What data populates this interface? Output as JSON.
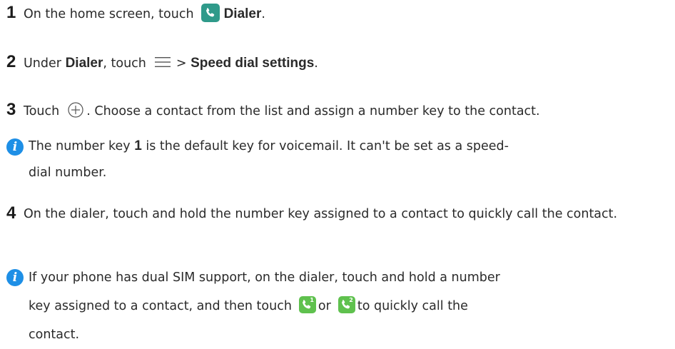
{
  "steps": [
    {
      "number": "1",
      "prefix": "On the home screen, touch",
      "icon": "dialer-app-icon",
      "bold": "Dialer",
      "suffix": "."
    },
    {
      "number": "2",
      "prefix": "Under",
      "bold1": "Dialer",
      "middle": ", touch",
      "icon": "menu-icon",
      "gt": ">",
      "bold2": "Speed dial settings",
      "suffix": "."
    },
    {
      "number": "3",
      "prefix": "Touch",
      "icon": "add-circle-icon",
      "suffix": ". Choose a contact from the list and assign a number key to the contact."
    },
    {
      "number": "4",
      "text": "On the dialer, touch and hold the number key assigned to a contact to quickly call the contact."
    }
  ],
  "notes": [
    {
      "icon": "info-icon",
      "icon_glyph": "i",
      "prefix": "The number key",
      "bold": "1",
      "suffix": "is the default key for voicemail. It can't be set as a speed-dial number."
    },
    {
      "icon": "info-icon",
      "icon_glyph": "i",
      "prefix": "If your phone has dual SIM support, on the dialer, touch and hold a number key assigned to a contact, and then touch",
      "icon1": "sim1-call-icon",
      "sim1_label": "1",
      "or": "or",
      "icon2": "sim2-call-icon",
      "sim2_label": "2",
      "suffix": "to quickly call the contact."
    }
  ],
  "colors": {
    "dialer_icon": "#2f9a8a",
    "info_icon": "#1e8fe6",
    "sim_icon": "#5fc14e",
    "text": "#2a2a2a"
  }
}
